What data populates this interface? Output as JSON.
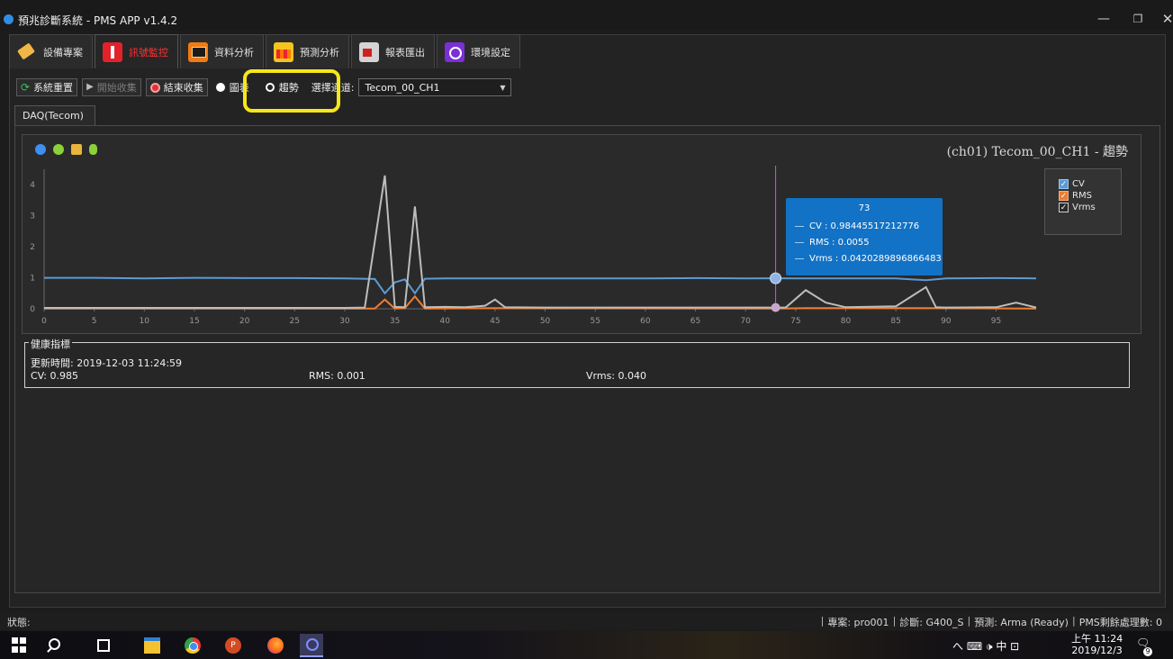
{
  "window": {
    "title": "預兆診斷系統 - PMS APP v1.4.2",
    "minimize": "—",
    "maximize": "❐",
    "close": "✕"
  },
  "top_tabs": [
    {
      "label": "設備專案",
      "icon": "tag-icon",
      "active": false
    },
    {
      "label": "訊號監控",
      "icon": "monitor-icon",
      "active": true
    },
    {
      "label": "資料分析",
      "icon": "analysis-icon",
      "active": false
    },
    {
      "label": "預測分析",
      "icon": "predict-icon",
      "active": false
    },
    {
      "label": "報表匯出",
      "icon": "report-icon",
      "active": false
    },
    {
      "label": "環境設定",
      "icon": "settings-icon",
      "active": false
    }
  ],
  "toolbar": {
    "reset_label": "系統重置",
    "start_label": "開始收集",
    "stop_label": "結束收集",
    "radio_chart_label": "圖表",
    "radio_trend_label": "趨勢",
    "channel_label": "選擇通道:",
    "channel_value": "Tecom_00_CH1"
  },
  "daq_tab": {
    "label": "DAQ(Tecom)"
  },
  "chart": {
    "title": "(ch01) Tecom_00_CH1 - 趨勢",
    "legend": [
      "CV",
      "RMS",
      "Vrms"
    ],
    "tooltip": {
      "x": "73",
      "cv": "CV : 0.98445517212776",
      "rms": "RMS : 0.0055",
      "vrms": "Vrms : 0.0420289896866483"
    }
  },
  "chart_data": {
    "type": "line",
    "xlim": [
      0,
      99
    ],
    "ylim": [
      0,
      4.5
    ],
    "x_ticks": [
      0,
      5,
      10,
      15,
      20,
      25,
      30,
      35,
      40,
      45,
      50,
      55,
      60,
      65,
      70,
      75,
      80,
      85,
      90,
      95
    ],
    "y_ticks": [
      0,
      1,
      2,
      3,
      4
    ],
    "cursor_x": 73,
    "legend_position": "right",
    "colors": {
      "CV": "#5b9bd5",
      "RMS": "#ed7d31",
      "Vrms": "#bdbdbd"
    },
    "series": [
      {
        "name": "CV",
        "points": [
          [
            0,
            1
          ],
          [
            5,
            1
          ],
          [
            10,
            0.98
          ],
          [
            15,
            1
          ],
          [
            20,
            0.99
          ],
          [
            25,
            0.99
          ],
          [
            30,
            0.98
          ],
          [
            33,
            0.96
          ],
          [
            34,
            0.5
          ],
          [
            35,
            0.85
          ],
          [
            36,
            0.95
          ],
          [
            37,
            0.5
          ],
          [
            38,
            0.97
          ],
          [
            40,
            0.98
          ],
          [
            45,
            0.98
          ],
          [
            50,
            0.98
          ],
          [
            55,
            0.98
          ],
          [
            60,
            0.98
          ],
          [
            65,
            0.99
          ],
          [
            70,
            0.98
          ],
          [
            73,
            0.984
          ],
          [
            75,
            0.98
          ],
          [
            80,
            0.98
          ],
          [
            85,
            0.98
          ],
          [
            88,
            0.92
          ],
          [
            90,
            0.98
          ],
          [
            95,
            0.99
          ],
          [
            99,
            0.98
          ]
        ]
      },
      {
        "name": "RMS",
        "points": [
          [
            0,
            0.005
          ],
          [
            33,
            0.005
          ],
          [
            34,
            0.3
          ],
          [
            35,
            0.01
          ],
          [
            36,
            0.02
          ],
          [
            37,
            0.4
          ],
          [
            38,
            0.01
          ],
          [
            45,
            0.02
          ],
          [
            73,
            0.0055
          ],
          [
            76,
            0.02
          ],
          [
            89,
            0.02
          ],
          [
            99,
            0.005
          ]
        ]
      },
      {
        "name": "Vrms",
        "points": [
          [
            0,
            0.03
          ],
          [
            30,
            0.03
          ],
          [
            32,
            0.04
          ],
          [
            34,
            4.3
          ],
          [
            35,
            0.06
          ],
          [
            36,
            0.05
          ],
          [
            37,
            3.3
          ],
          [
            38,
            0.05
          ],
          [
            40,
            0.06
          ],
          [
            42,
            0.05
          ],
          [
            44,
            0.1
          ],
          [
            45,
            0.3
          ],
          [
            46,
            0.05
          ],
          [
            50,
            0.04
          ],
          [
            55,
            0.04
          ],
          [
            60,
            0.04
          ],
          [
            65,
            0.04
          ],
          [
            70,
            0.04
          ],
          [
            73,
            0.042
          ],
          [
            74,
            0.04
          ],
          [
            76,
            0.6
          ],
          [
            78,
            0.2
          ],
          [
            80,
            0.05
          ],
          [
            85,
            0.08
          ],
          [
            88,
            0.7
          ],
          [
            89,
            0.05
          ],
          [
            90,
            0.04
          ],
          [
            95,
            0.05
          ],
          [
            97,
            0.2
          ],
          [
            99,
            0.04
          ]
        ]
      }
    ]
  },
  "health": {
    "legend": "健康指標",
    "updated": "更新時間: 2019-12-03 11:24:59",
    "cv": "CV: 0.985",
    "rms": "RMS: 0.001",
    "vrms": "Vrms: 0.040"
  },
  "statusbar": {
    "left": "狀態:",
    "project": "專案: pro001",
    "diagnosis": "診斷: G400_S",
    "prediction": "預測: Arma (Ready)",
    "pms_count": "PMS剩餘處理數: 0"
  },
  "taskbar": {
    "tray": "へ ⌨ 🕩 中 ⊡",
    "time": "上午 11:24",
    "date": "2019/12/3",
    "notify_count": "9"
  }
}
